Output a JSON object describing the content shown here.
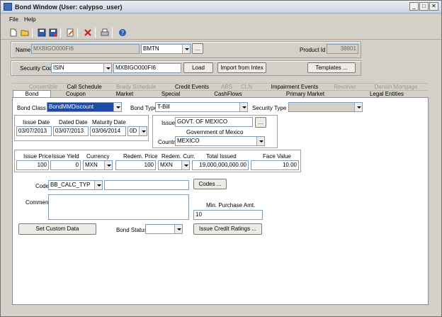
{
  "window": {
    "title": "Bond Window (User: calypso_user)"
  },
  "menu": {
    "file": "File",
    "help": "Help"
  },
  "toolbar_icons": [
    "new-icon",
    "open-icon",
    "save-icon",
    "save-as-icon",
    "edit-icon",
    "delete-icon",
    "print-icon",
    "help-icon"
  ],
  "header": {
    "name_label": "Name",
    "name_value": "MXBIGO000FI6",
    "name_type": "BMTN",
    "ellipsis": "...",
    "product_id_label": "Product Id",
    "product_id_value": "38801"
  },
  "security": {
    "code_label": "Security Code",
    "code_type": "ISIN",
    "code_value": "MXBIGO000FI6",
    "load_button": "Load",
    "import_button": "Import from Intex",
    "templates_button": "Templates ..."
  },
  "tabs_row1": [
    "Convertible",
    "Call Schedule",
    "Brady Schedule",
    "Credit Events",
    "ABS",
    "CLN",
    "Impairment Events",
    "Revolver",
    "Danish Mortgage"
  ],
  "tabs_row2": [
    "Bond",
    "Coupon",
    "Market",
    "Special",
    "CashFlows",
    "Primary Market",
    "Legal Entities"
  ],
  "bond": {
    "bond_class_label": "Bond Class",
    "bond_class_value": "BondMMDiscount",
    "bond_type_label": "Bond Type",
    "bond_type_value": "T-Bill",
    "security_type_label": "Security Type",
    "security_type_value": "",
    "issue_date_label": "Issue Date",
    "issue_date_value": "03/07/2013",
    "dated_date_label": "Dated Date",
    "dated_date_value": "03/07/2013",
    "maturity_date_label": "Maturity Date",
    "maturity_date_value": "03/06/2014",
    "maturity_tenor": "0D",
    "issuer_label": "Issuer",
    "issuer_value": "GOVT. OF MEXICO",
    "issuer_full": "Government of Mexico",
    "country_label": "Country",
    "country_value": "MEXICO",
    "issue_price_label": "Issue Price",
    "issue_price_value": "100",
    "issue_yield_label": "Issue Yield",
    "issue_yield_value": "0",
    "currency_label": "Currency",
    "currency_value": "MXN",
    "redem_price_label": "Redem. Price",
    "redem_price_value": "100",
    "redem_curr_label": "Redem. Curr.",
    "redem_curr_value": "MXN",
    "total_issued_label": "Total Issued",
    "total_issued_value": "19,000,000,000.00",
    "face_value_label": "Face Value",
    "face_value_value": "10.00",
    "code_label": "Code",
    "code_type": "BB_CALC_TYP",
    "code_value": "",
    "codes_button": "Codes ...",
    "comment_label": "Comment",
    "min_purchase_label": "Min. Purchase Amt.",
    "min_purchase_value": "10",
    "set_custom_button": "Set Custom Data",
    "bond_status_label": "Bond Status",
    "bond_status_value": "",
    "credit_ratings_button": "Issue Credit Ratings ..."
  }
}
